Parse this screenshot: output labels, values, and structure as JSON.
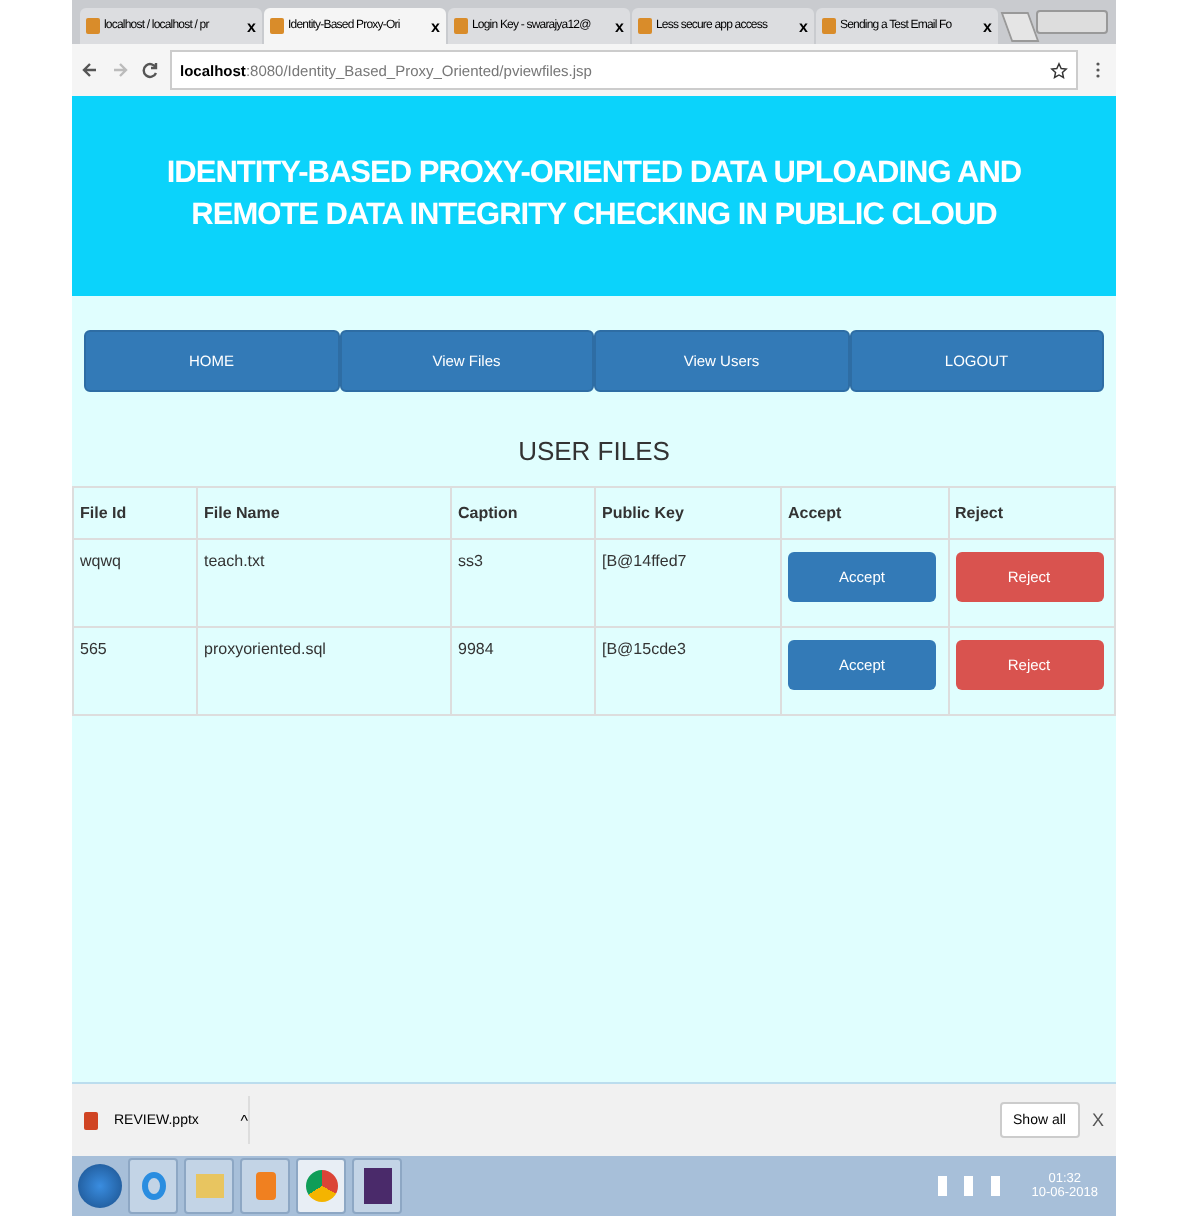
{
  "browser": {
    "tabs": [
      {
        "title": "localhost / localhost / pr",
        "close": "x",
        "selected": false
      },
      {
        "title": "Identity-Based Proxy-Ori",
        "close": "x",
        "selected": true
      },
      {
        "title": "Login Key - swarajya12@",
        "close": "x",
        "selected": false
      },
      {
        "title": "Less secure app access",
        "close": "x",
        "selected": false
      },
      {
        "title": "Sending a Test Email Fo",
        "close": "x",
        "selected": false
      }
    ],
    "url_host": "localhost",
    "url_rest": ":8080/Identity_Based_Proxy_Oriented/pviewfiles.jsp"
  },
  "header": {
    "title": "IDENTITY-BASED PROXY-ORIENTED DATA UPLOADING AND REMOTE DATA INTEGRITY CHECKING IN PUBLIC CLOUD"
  },
  "nav": [
    "HOME",
    "View Files",
    "View Users",
    "LOGOUT"
  ],
  "section_title": "USER FILES",
  "table": {
    "columns": [
      "File Id",
      "File Name",
      "Caption",
      "Public Key",
      "Accept",
      "Reject"
    ],
    "rows": [
      {
        "file_id": "wqwq",
        "file_name": "teach.txt",
        "caption": "ss3",
        "public_key": "[B@14ffed7",
        "accept": "Accept",
        "reject": "Reject"
      },
      {
        "file_id": "565",
        "file_name": "proxyoriented.sql",
        "caption": "9984",
        "public_key": "[B@15cde3",
        "accept": "Accept",
        "reject": "Reject"
      }
    ]
  },
  "download_bar": {
    "file": "REVIEW.pptx",
    "caret": "^",
    "show_all": "Show all",
    "close": "X"
  },
  "taskbar": {
    "time": "01:32",
    "date": "10-06-2018"
  }
}
